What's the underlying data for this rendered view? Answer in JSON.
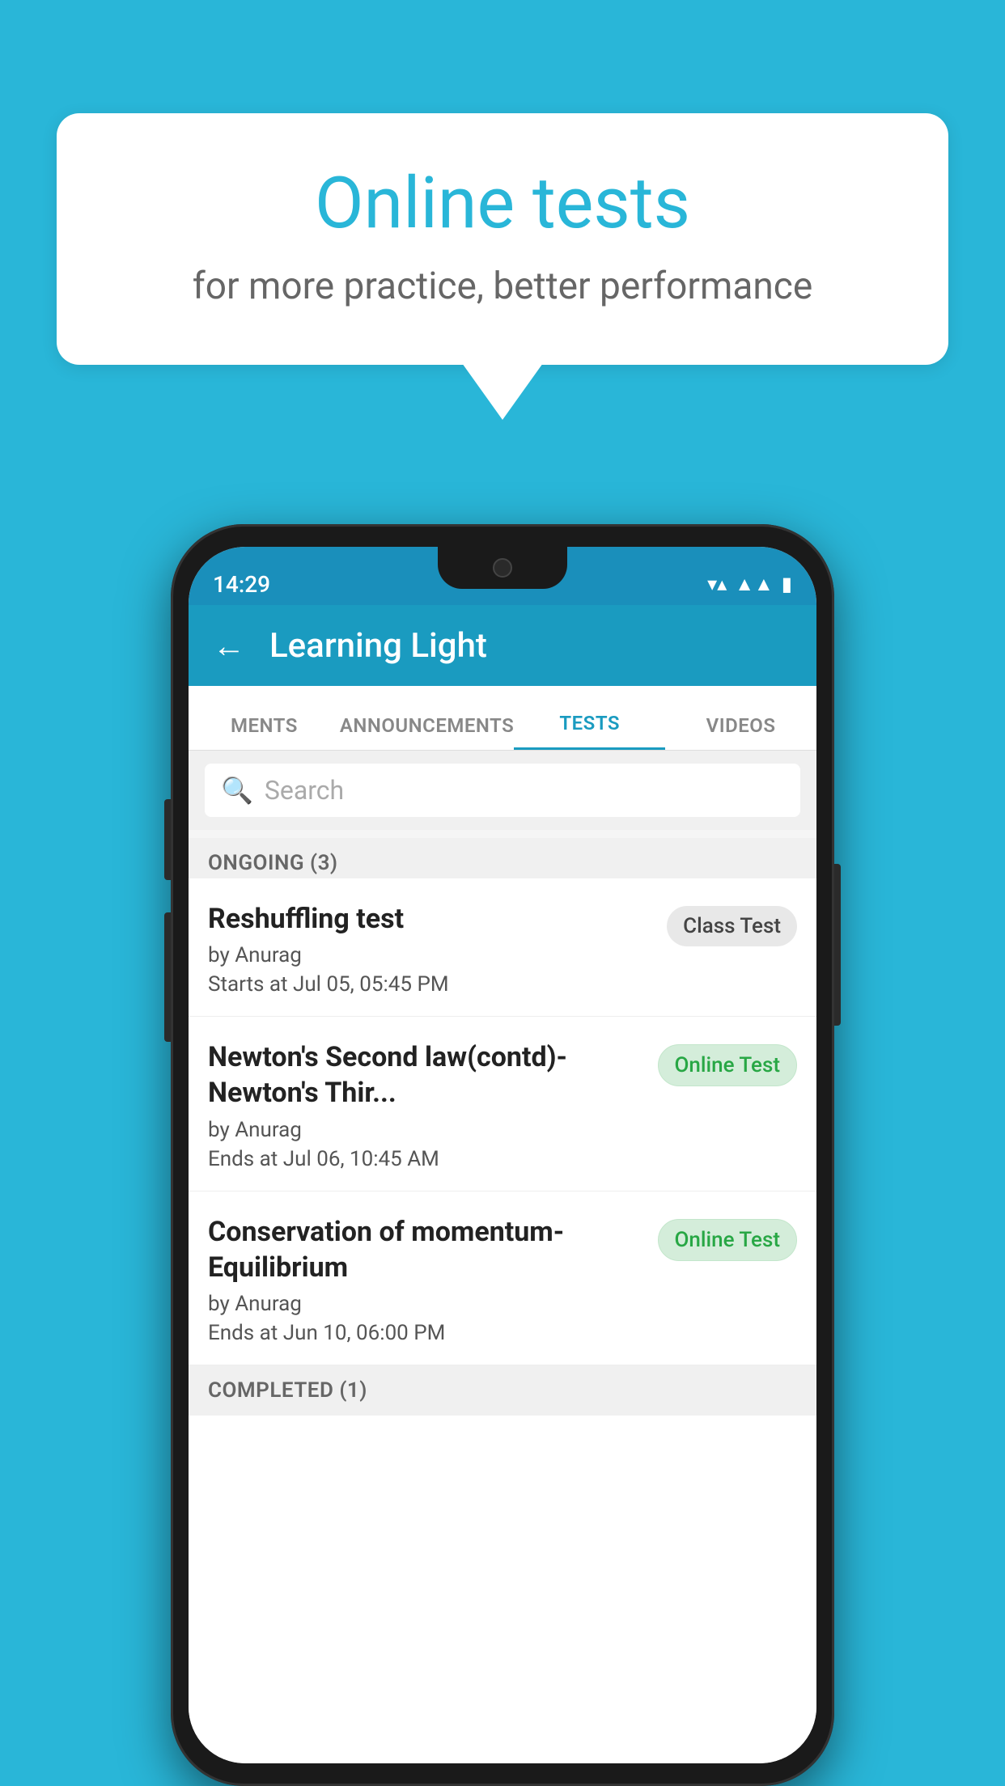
{
  "background": {
    "color": "#29b6d8"
  },
  "speech_bubble": {
    "title": "Online tests",
    "subtitle": "for more practice, better performance"
  },
  "phone": {
    "status_bar": {
      "time": "14:29",
      "icons": [
        "wifi",
        "signal",
        "battery"
      ]
    },
    "app_bar": {
      "back_label": "←",
      "title": "Learning Light"
    },
    "tabs": [
      {
        "label": "MENTS",
        "active": false
      },
      {
        "label": "ANNOUNCEMENTS",
        "active": false
      },
      {
        "label": "TESTS",
        "active": true
      },
      {
        "label": "VIDEOS",
        "active": false
      }
    ],
    "search": {
      "placeholder": "Search"
    },
    "ongoing_section": {
      "label": "ONGOING (3)"
    },
    "test_items": [
      {
        "title": "Reshuffling test",
        "author": "by Anurag",
        "date": "Starts at  Jul 05, 05:45 PM",
        "badge": "Class Test",
        "badge_type": "class"
      },
      {
        "title": "Newton's Second law(contd)-Newton's Thir...",
        "author": "by Anurag",
        "date": "Ends at  Jul 06, 10:45 AM",
        "badge": "Online Test",
        "badge_type": "online"
      },
      {
        "title": "Conservation of momentum-Equilibrium",
        "author": "by Anurag",
        "date": "Ends at  Jun 10, 06:00 PM",
        "badge": "Online Test",
        "badge_type": "online"
      }
    ],
    "completed_section": {
      "label": "COMPLETED (1)"
    }
  }
}
